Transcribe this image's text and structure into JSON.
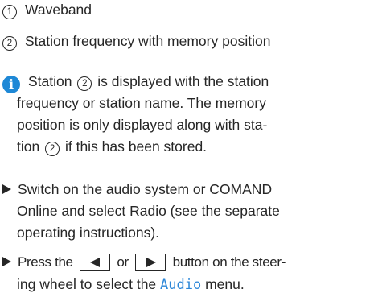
{
  "legend": {
    "items": [
      {
        "number": "1",
        "text": "Waveband"
      },
      {
        "number": "2",
        "text": "Station frequency with memory position"
      }
    ]
  },
  "note": {
    "icon": "info-icon",
    "lines": [
      {
        "before": "Station",
        "ref": "2",
        "after": "is displayed with the station"
      },
      {
        "text": "frequency or station name. The memory"
      },
      {
        "text": "position is only displayed along with sta-"
      },
      {
        "before": "tion",
        "ref": "2",
        "after": "if this has been stored."
      }
    ]
  },
  "steps": [
    {
      "lines": [
        "Switch on the audio system or COMAND",
        "Online and select Radio (see the separate",
        "operating instructions)."
      ]
    },
    {
      "line1": {
        "before": "Press the",
        "left_key_icon": "left-arrow-key-icon",
        "middle": "or",
        "right_key_icon": "right-arrow-key-icon",
        "after": "button on the steer-"
      },
      "line2": {
        "before": "ing wheel to select the",
        "menu_word": "Audio",
        "after": "menu."
      }
    }
  ],
  "colors": {
    "text": "#262626",
    "info_icon": "#1e88d6",
    "menu_highlight": "#2b86d8"
  }
}
